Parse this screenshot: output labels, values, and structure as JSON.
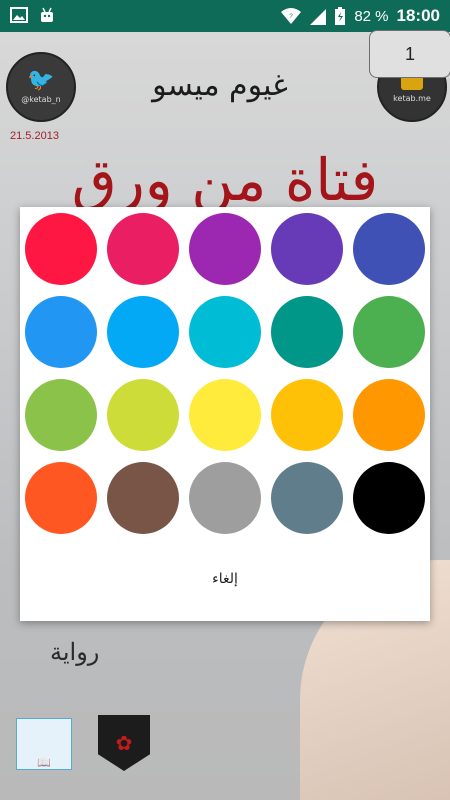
{
  "status_bar": {
    "battery": "82 %",
    "time": "18:00",
    "icons": [
      "image-icon",
      "android-icon",
      "wifi-icon",
      "signal-icon",
      "battery-icon"
    ]
  },
  "cover": {
    "twitter_handle": "@ketab_n",
    "date": "21.5.2013",
    "author": "غيوم ميسو",
    "ketab_label": "ketab.me",
    "title": "فتاة من ورق",
    "genre": "رواية"
  },
  "page_indicator": "1",
  "color_dialog": {
    "colors": [
      "#ff1744",
      "#e91e63",
      "#9c27b0",
      "#673ab7",
      "#3f51b5",
      "#2196f3",
      "#03a9f4",
      "#00bcd4",
      "#009688",
      "#4caf50",
      "#8bc34a",
      "#cddc39",
      "#ffeb3b",
      "#ffc107",
      "#ff9800",
      "#ff5722",
      "#795548",
      "#9e9e9e",
      "#607d8b",
      "#000000"
    ],
    "cancel_label": "إلغاء"
  }
}
